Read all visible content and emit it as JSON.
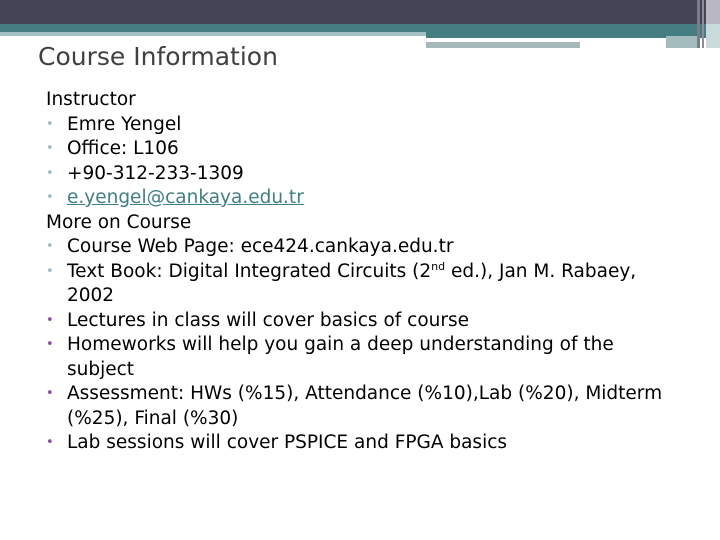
{
  "colors": {
    "header_dark": "#424355",
    "header_teal": "#447d82",
    "bullet_blue": "#9fb8c8",
    "bullet_purple": "#8a4f9e",
    "link": "#3f7f86",
    "title": "#404040"
  },
  "slide": {
    "title": "Course Information",
    "sections": [
      {
        "heading": "Instructor",
        "items": [
          {
            "text": "Emre Yengel"
          },
          {
            "text": "Office: L106"
          },
          {
            "text": "+90-312-233-1309"
          },
          {
            "text": "e.yengel@cankaya.edu.tr",
            "link": true
          }
        ]
      },
      {
        "heading": "More on Course",
        "items": [
          {
            "text": "Course Web Page: ece424.cankaya.edu.tr"
          },
          {
            "text_before": "Text Book: Digital Integrated Circuits (2",
            "sup": "nd",
            "text_after": " ed.), Jan M. Rabaey, 2002"
          },
          {
            "text": "Lectures in class will cover basics of course"
          },
          {
            "text": "Homeworks will help you gain a deep understanding of the subject"
          },
          {
            "text": "Assessment: HWs (%15), Attendance (%10),Lab (%20), Midterm (%25), Final (%30)"
          },
          {
            "text": "Lab sessions will cover PSPICE and FPGA basics"
          }
        ]
      }
    ],
    "bullet_glyph": "•"
  }
}
